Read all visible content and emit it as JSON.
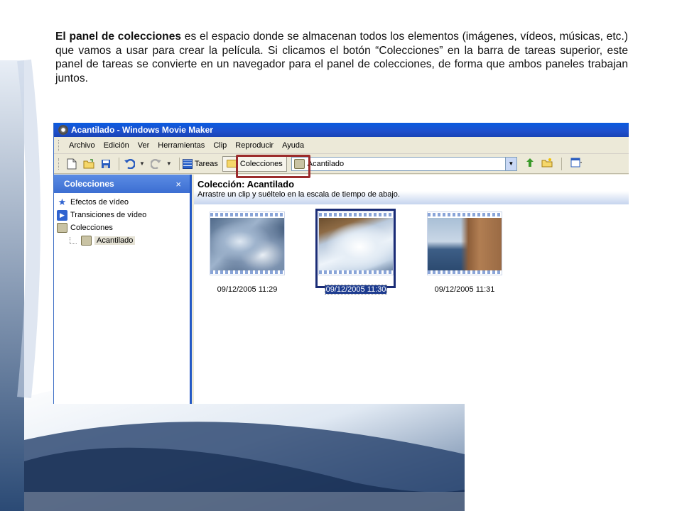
{
  "paragraph": {
    "bold_lead": "El panel de colecciones",
    "rest": " es el espacio donde se almacenan todos los elementos (imágenes, vídeos, músicas, etc.) que vamos a usar para crear la película. Si clicamos el botón “Colecciones” en la barra de tareas superior, este panel de tareas se convierte en un navegador para el panel de colecciones, de forma que ambos paneles trabajan juntos."
  },
  "window": {
    "title": "Acantilado - Windows Movie Maker",
    "menu": [
      "Archivo",
      "Edición",
      "Ver",
      "Herramientas",
      "Clip",
      "Reproducir",
      "Ayuda"
    ],
    "toolbar": {
      "tareas_label": "Tareas",
      "colecciones_label": "Colecciones",
      "collection_select_value": "Acantilado"
    }
  },
  "left_panel": {
    "header": "Colecciones",
    "close_glyph": "×",
    "tree": {
      "effects": "Efectos de vídeo",
      "transitions": "Transiciones de vídeo",
      "collections": "Colecciones",
      "selected_child": "Acantilado"
    }
  },
  "collection": {
    "title": "Colección: Acantilado",
    "subtitle": "Arrastre un clip y suéltelo en la escala de tiempo de abajo.",
    "clips": [
      {
        "date": "09/12/2005 11:29",
        "selected": false
      },
      {
        "date": "09/12/2005 11:30",
        "selected": true
      },
      {
        "date": "09/12/2005 11:31",
        "selected": false
      }
    ]
  },
  "colors": {
    "highlight_box": "#9b2b2b",
    "selection": "#1c3b8f",
    "titlebar": "#1e4fcc"
  }
}
